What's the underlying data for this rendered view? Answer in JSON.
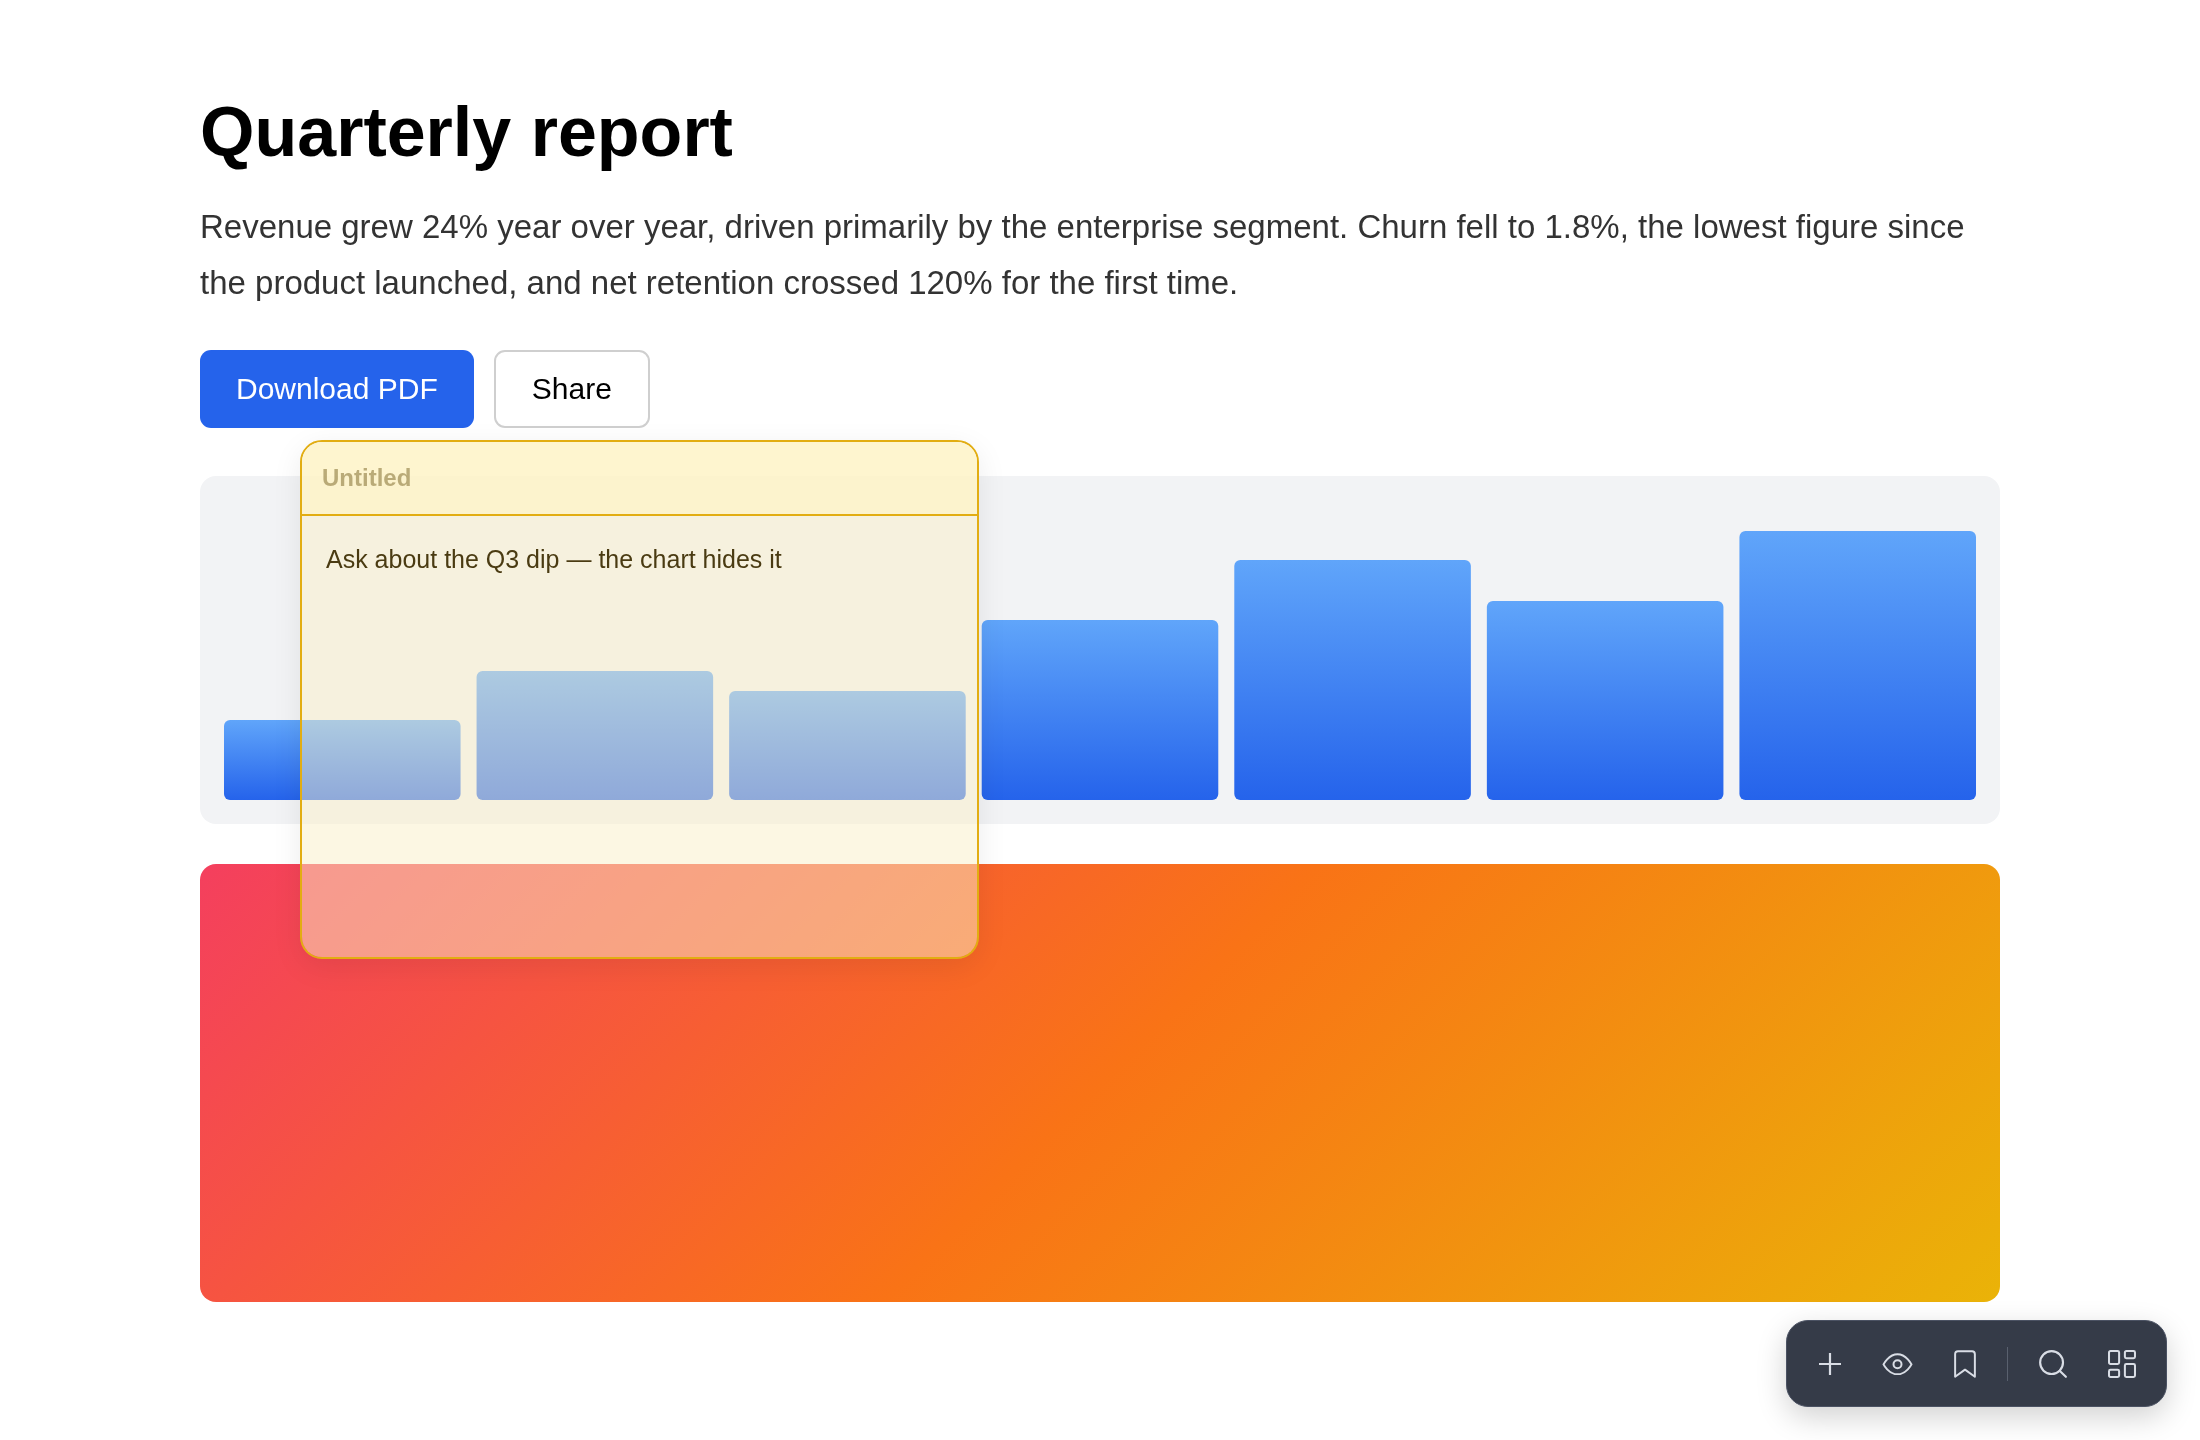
{
  "title": "Quarterly report",
  "summary": "Revenue grew 24% year over year, driven primarily by the enterprise segment. Churn fell to 1.8%, the lowest figure since the product launched, and net retention crossed 120% for the first time.",
  "buttons": [
    {
      "label": "Download PDF",
      "kind": "primary"
    },
    {
      "label": "Share",
      "kind": "secondary"
    }
  ],
  "sticky_note": {
    "title": {
      "placeholder": "Untitled"
    },
    "text": "Ask about the Q3 dip — the chart hides it"
  }
}
